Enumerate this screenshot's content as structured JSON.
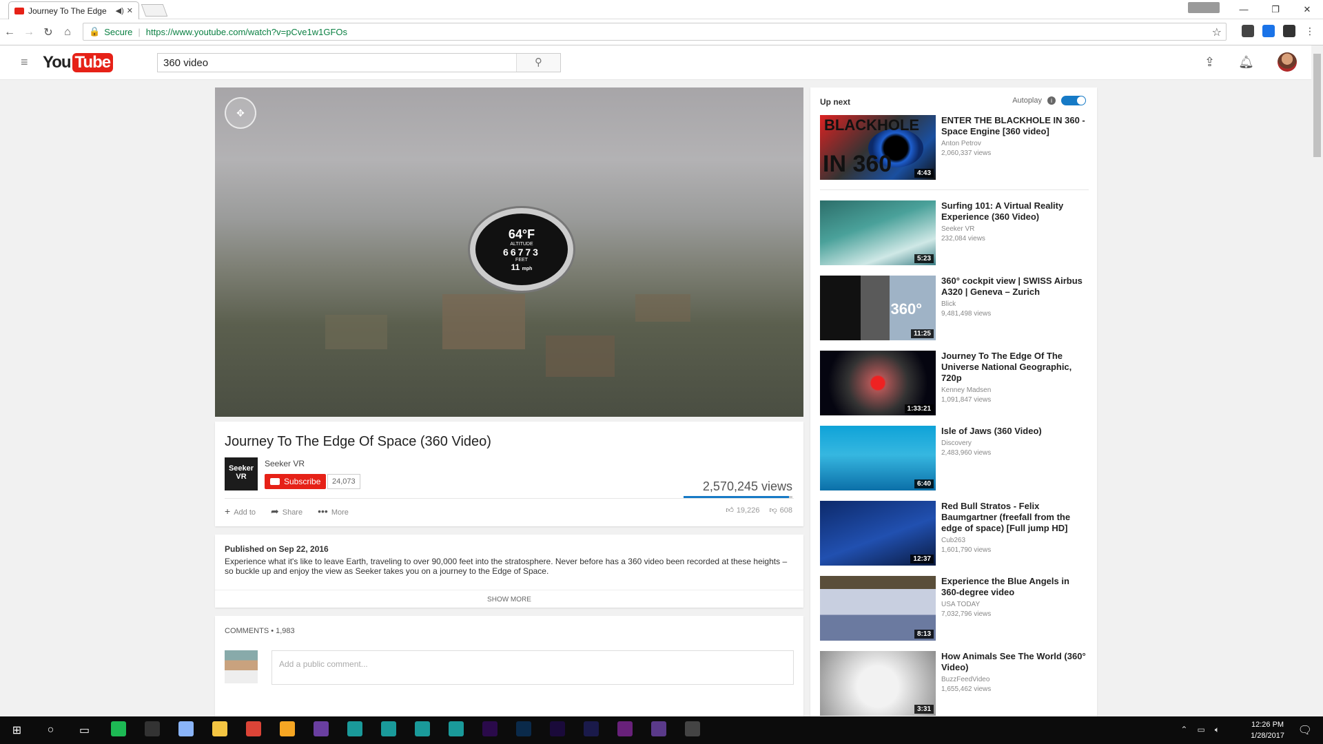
{
  "browser": {
    "tab_title": "Journey To The Edge",
    "tab_audio": "◀)",
    "tab_close": "✕",
    "window_controls": [
      "—",
      "❐",
      "✕"
    ],
    "secure_label": "Secure",
    "url": "https://www.youtube.com/watch?v=pCve1w1GFOs"
  },
  "header": {
    "logo_you": "You",
    "logo_tube": "Tube",
    "search_value": "360 video"
  },
  "player": {
    "overlay": {
      "temp": "64°F",
      "altitude_label": "ALTITUDE",
      "altitude": "66773",
      "feet_label": "FEET",
      "speed": "11",
      "speed_unit": "mph"
    }
  },
  "video": {
    "title": "Journey To The Edge Of Space (360 Video)",
    "channel_avatar_text": "Seeker VR",
    "channel": "Seeker VR",
    "subscribe_label": "Subscribe",
    "subscriber_count": "24,073",
    "views": "2,570,245 views",
    "like_ratio": 0.97,
    "actions": [
      {
        "icon": "plus-icon",
        "glyph": "+",
        "label": "Add to"
      },
      {
        "icon": "share-icon",
        "glyph": "➦",
        "label": "Share"
      },
      {
        "icon": "more-icon",
        "glyph": "•••",
        "label": "More"
      }
    ],
    "likes": "19,226",
    "dislikes": "608"
  },
  "description": {
    "published": "Published on Sep 22, 2016",
    "text": "Experience what it's like to leave Earth, traveling to over 90,000 feet into the stratosphere. Never before has a 360 video been recorded at these heights – so buckle up and enjoy the view as Seeker takes you on a journey to the Edge of Space.",
    "show_more": "SHOW MORE"
  },
  "comments": {
    "header": "COMMENTS • 1,983",
    "placeholder": "Add a public comment..."
  },
  "sidebar": {
    "up_next": "Up next",
    "autoplay": "Autoplay",
    "items": [
      {
        "title": "ENTER THE BLACKHOLE IN 360 - Space Engine [360 video]",
        "channel": "Anton Petrov",
        "views": "2,060,337 views",
        "duration": "4:43",
        "thumb_text_1": "BLACKHOLE",
        "thumb_text_2": "IN 360"
      },
      {
        "title": "Surfing 101: A Virtual Reality Experience (360 Video)",
        "channel": "Seeker VR",
        "views": "232,084 views",
        "duration": "5:23"
      },
      {
        "title": "360° cockpit view | SWISS Airbus A320 | Geneva – Zurich",
        "channel": "Blick",
        "views": "9,481,498 views",
        "duration": "11:25",
        "thumb_text_1": "360°"
      },
      {
        "title": "Journey To The Edge Of The Universe National Geographic, 720p",
        "channel": "Kenney Madsen",
        "views": "1,091,847 views",
        "duration": "1:33:21"
      },
      {
        "title": "Isle of Jaws (360 Video)",
        "channel": "Discovery",
        "views": "2,483,960 views",
        "duration": "6:40"
      },
      {
        "title": "Red Bull Stratos - Felix Baumgartner (freefall from the edge of space) [Full jump HD]",
        "channel": "Cub263",
        "views": "1,601,790 views",
        "duration": "12:37"
      },
      {
        "title": "Experience the Blue Angels in 360-degree video",
        "channel": "USA TODAY",
        "views": "7,032,796 views",
        "duration": "8:13"
      },
      {
        "title": "How Animals See The World (360° Video)",
        "channel": "BuzzFeedVideo",
        "views": "1,655,462 views",
        "duration": "3:31"
      }
    ]
  },
  "taskbar": {
    "time": "12:26 PM",
    "date": "1/28/2017",
    "apps": [
      {
        "name": "spotify",
        "color": "#1db954"
      },
      {
        "name": "terminal",
        "color": "#333333"
      },
      {
        "name": "notepad",
        "color": "#8ab4f8"
      },
      {
        "name": "explorer",
        "color": "#f4c542"
      },
      {
        "name": "chrome",
        "color": "#db4437"
      },
      {
        "name": "notes",
        "color": "#f6a623"
      },
      {
        "name": "app-purple",
        "color": "#6a3fa0"
      },
      {
        "name": "app-teal-1",
        "color": "#1a9a9a"
      },
      {
        "name": "app-teal-2",
        "color": "#1a9a9a"
      },
      {
        "name": "app-teal-3",
        "color": "#1a9a9a"
      },
      {
        "name": "app-teal-4",
        "color": "#1a9a9a"
      },
      {
        "name": "premiere",
        "color": "#2a0a4a"
      },
      {
        "name": "photoshop",
        "color": "#0a2a4a"
      },
      {
        "name": "after-effects",
        "color": "#1a0a3a"
      },
      {
        "name": "lightroom",
        "color": "#1a1a4a"
      },
      {
        "name": "visual-studio",
        "color": "#68217a"
      },
      {
        "name": "app-circle",
        "color": "#5a3a8a"
      },
      {
        "name": "unity",
        "color": "#444444"
      }
    ]
  },
  "colors": {
    "brand": "#e62117",
    "link": "#167ac6",
    "secure": "#0b8043"
  }
}
